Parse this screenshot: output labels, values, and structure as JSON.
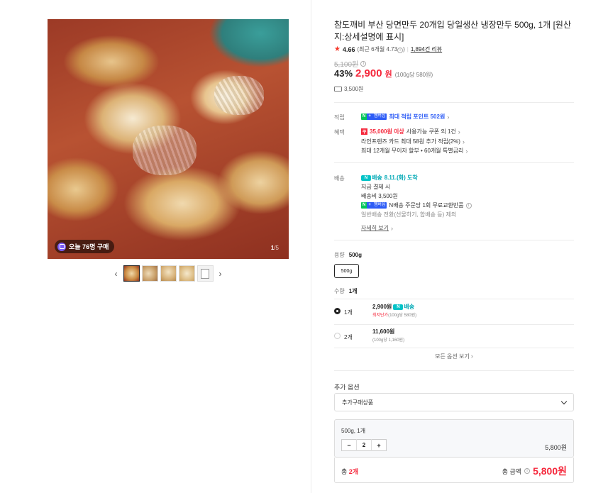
{
  "gallery": {
    "buy_badge": "오늘 76명 구매",
    "counter_current": "1",
    "counter_total": "/5",
    "thumbnails": [
      "thumb-1",
      "thumb-2",
      "thumb-3",
      "thumb-4",
      "thumb-5"
    ],
    "prev_icon": "‹",
    "next_icon": "›"
  },
  "product": {
    "title": "참도깨비 부산 당면만두 20개입 당일생산 냉장만두 500g, 1개 [원산지:상세설명에 표시]",
    "rating": "4.66",
    "rating_recent": "(최근 6개월 4.73",
    "rating_recent_close": ")",
    "review_count": "1,894건 리뷰",
    "original_price": "5,100원",
    "discount": "43%",
    "price": "2,900",
    "price_unit": "원",
    "unit_price": "(100g당 580원)",
    "shipping_fee": "3,500원"
  },
  "benefits": {
    "point_label": "적립",
    "point_badge_n": "N",
    "point_badge_plus": "+",
    "point_badge_member": "멤버십",
    "point_text": "최대 적립 포인트 502원",
    "benefit_label": "혜택",
    "coupon_tag": "쿠",
    "coupon_amount": "35,000원 이상",
    "coupon_text": "사용가능 쿠폰 외 1건",
    "card_text": "라인프렌즈 카드 최대 58원 추가 적립(2%)",
    "installment_text": "최대 12개월 무이자 할부 • 60개월 특별금리"
  },
  "delivery": {
    "label": "배송",
    "nship_box": "N",
    "nship_label": "배송",
    "arrival": "8.11.(화) 도착",
    "pay_now": "지금 결제 시",
    "fee": "배송비 3,500원",
    "badge_n": "N",
    "badge_plus": "+",
    "badge_member": "멤버십",
    "free_return": "N배송 주문당 1회 무료교환반품",
    "exclusion": "일반배송 전환(선물하기, 합배송 등) 제외",
    "detail_link": "자세히 보기"
  },
  "options": {
    "capacity_label": "용량",
    "capacity_selected": "500g",
    "capacity_chip": "500g",
    "quantity_label": "수량",
    "quantity_selected": "1개",
    "items": [
      {
        "label": "1개",
        "price": "2,900원",
        "badge": "배송",
        "sub_red": "최저단가",
        "sub": "(100g당 580원)"
      },
      {
        "label": "2개",
        "price": "11,600원",
        "badge": "",
        "sub_red": "",
        "sub": "(100g당 1,160원)"
      }
    ],
    "all_options": "모든 옵션 보기"
  },
  "extra": {
    "label": "추가 옵션",
    "select_value": "추가구매상품"
  },
  "summary": {
    "option_name": "500g, 1개",
    "minus": "−",
    "qty": "2",
    "plus": "+",
    "subtotal": "5,800원",
    "total_prefix": "총",
    "total_count": "2개",
    "total_label": "총 금액",
    "total_amount": "5,800원"
  },
  "colors": {
    "accent_red": "#f5283c",
    "npay_green": "#03c75a",
    "member_blue": "#2d5cf6",
    "nship_teal": "#03a9b6"
  }
}
